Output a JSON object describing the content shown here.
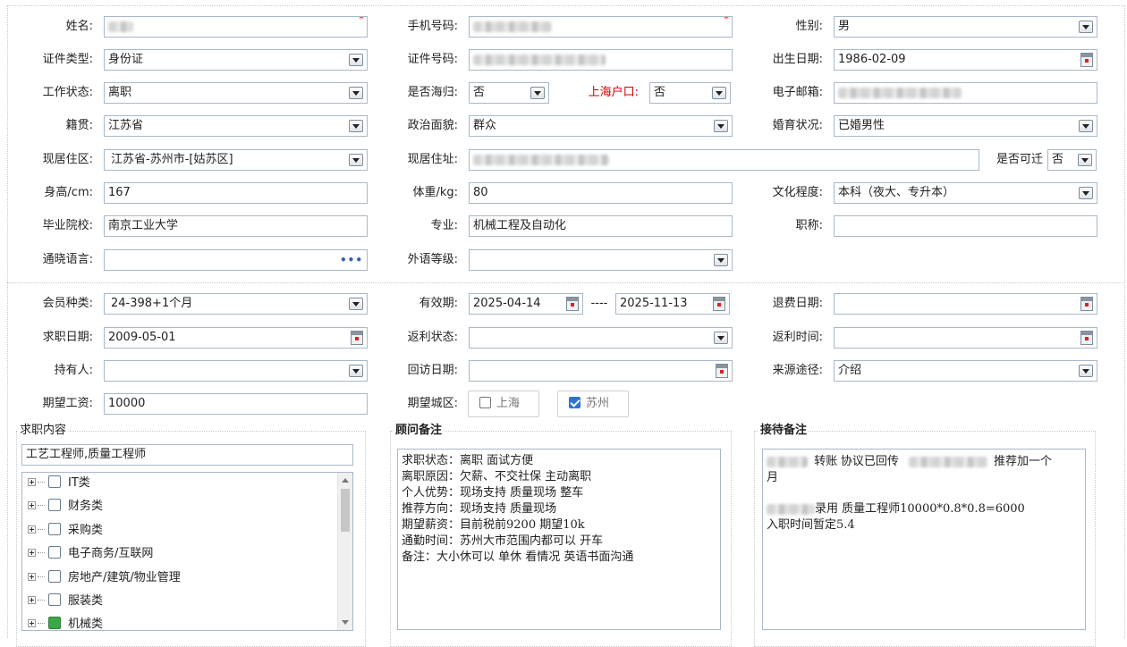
{
  "personal": {
    "name": {
      "label": "姓名:",
      "required_mark": "*"
    },
    "phone": {
      "label": "手机号码:",
      "required_mark": "*"
    },
    "gender": {
      "label": "性别:",
      "value": "男"
    },
    "id_type": {
      "label": "证件类型:",
      "value": "身份证"
    },
    "id_number": {
      "label": "证件号码:"
    },
    "birth_date": {
      "label": "出生日期:",
      "value": "1986-02-09"
    },
    "work_status": {
      "label": "工作状态:",
      "value": "离职"
    },
    "returnee": {
      "label": "是否海归:",
      "value": "否"
    },
    "shanghai_hukou": {
      "label": "上海户口:",
      "value": "否",
      "color": "#d40000"
    },
    "email": {
      "label": "电子邮箱:"
    },
    "native_place": {
      "label": "籍贯:",
      "value": "江苏省"
    },
    "political": {
      "label": "政治面貌:",
      "value": "群众"
    },
    "marital": {
      "label": "婚育状况:",
      "value": "已婚男性"
    },
    "residence_area": {
      "label": "现居住区:",
      "value": "江苏省-苏州市-[姑苏区]"
    },
    "address": {
      "label": "现居住址:"
    },
    "relocate": {
      "label": "是否可迁",
      "value": "否"
    },
    "height": {
      "label": "身高/cm:",
      "value": "167"
    },
    "weight": {
      "label": "体重/kg:",
      "value": "80"
    },
    "education": {
      "label": "文化程度:",
      "value": "本科（夜大、专升本）"
    },
    "school": {
      "label": "毕业院校:",
      "value": "南京工业大学"
    },
    "major": {
      "label": "专业:",
      "value": "机械工程及自动化"
    },
    "title": {
      "label": "职称:",
      "value": ""
    },
    "languages": {
      "label": "通晓语言:",
      "value": "",
      "more": "•••"
    },
    "foreign_level": {
      "label": "外语等级:",
      "value": ""
    }
  },
  "membership": {
    "member_type": {
      "label": "会员种类:",
      "value": "24-398+1个月"
    },
    "valid_period": {
      "label": "有效期:",
      "start": "2025-04-14",
      "separator": "----",
      "end": "2025-11-13"
    },
    "refund_date": {
      "label": "退费日期:",
      "value": ""
    },
    "job_seek_date": {
      "label": "求职日期:",
      "value": "2009-05-01"
    },
    "rebate_status": {
      "label": "返利状态:",
      "value": ""
    },
    "rebate_time": {
      "label": "返利时间:",
      "value": ""
    },
    "holder": {
      "label": "持有人:",
      "value": ""
    },
    "revisit_date": {
      "label": "回访日期:",
      "value": ""
    },
    "source": {
      "label": "来源途径:",
      "value": "介绍"
    },
    "expected_salary": {
      "label": "期望工资:",
      "value": "10000"
    },
    "expected_city": {
      "label": "期望城区:",
      "options": [
        {
          "label": "上海",
          "checked": false
        },
        {
          "label": "苏州",
          "checked": true
        }
      ]
    }
  },
  "job_content": {
    "legend": "求职内容",
    "value": "工艺工程师,质量工程师",
    "tree": [
      "IT类",
      "财务类",
      "采购类",
      "电子商务/互联网",
      "房地产/建筑/物业管理",
      "服装类",
      "机械类"
    ]
  },
  "consultant_notes": {
    "legend": "顾问备注",
    "lines": [
      "求职状态：离职 面试方便",
      "离职原因：欠薪、不交社保 主动离职",
      "个人优势：现场支持 质量现场   整车",
      "推荐方向：现场支持 质量现场",
      "期望薪资：目前税前9200 期望10k",
      "通勤时间：苏州大市范围内都可以   开车",
      "备注：大小休可以 单休 看情况  英语书面沟通"
    ]
  },
  "reception_notes": {
    "legend": "接待备注",
    "line1_a": "转账  协议已回传",
    "line1_b": "推荐加一个",
    "line2": "月",
    "line3": "录用  质量工程师10000*0.8*0.8=6000",
    "line4": "入职时间暂定5.4"
  }
}
